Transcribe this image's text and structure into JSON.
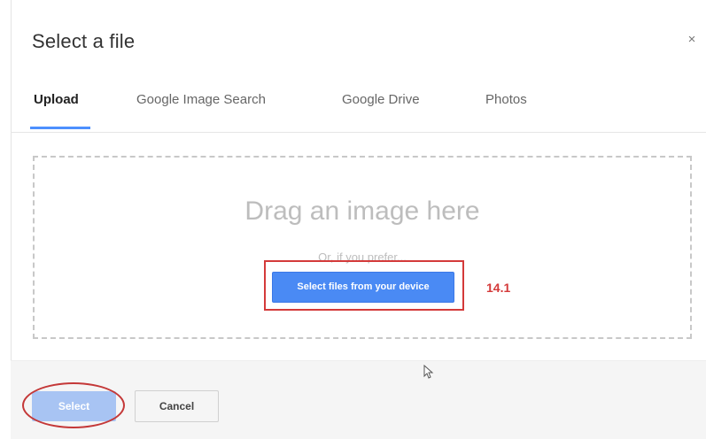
{
  "dialog": {
    "title": "Select a file",
    "close_icon": "close-icon",
    "close_glyph": "×"
  },
  "tabs": [
    {
      "label": "Upload",
      "active": true
    },
    {
      "label": "Google Image Search",
      "active": false
    },
    {
      "label": "Google Drive",
      "active": false
    },
    {
      "label": "Photos",
      "active": false
    }
  ],
  "dropzone": {
    "headline": "Drag an image here",
    "subtext": "Or, if you prefer...",
    "button_label": "Select files from your device"
  },
  "annotation": {
    "label": "14.1",
    "color": "#d43a3a"
  },
  "footer": {
    "select_label": "Select",
    "cancel_label": "Cancel"
  },
  "colors": {
    "accent": "#4a8af4",
    "tab_underline": "#4d90fe",
    "select_disabled": "#a8c4f3",
    "annotation_red": "#d43a3a"
  },
  "icons": {
    "close": "close-icon",
    "cursor": "mouse-cursor-icon"
  }
}
